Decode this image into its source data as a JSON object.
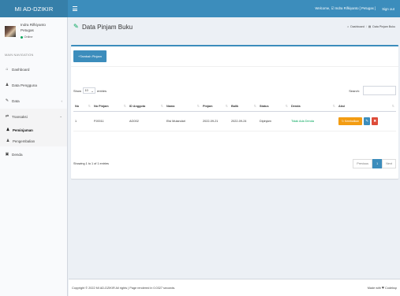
{
  "app": {
    "logo": "MI AD-DZIKIR"
  },
  "topbar": {
    "welcome": "Welcome, ☑ Indra Rifkiyanto [ Petugas ]",
    "signout": "Sign out"
  },
  "user": {
    "name": "Indra Rifkiyanto",
    "role": "Petugas",
    "status": "Online"
  },
  "sidebar": {
    "header": "MAIN NAVIGATION",
    "items": [
      {
        "icon": "⌂",
        "label": "Dashboard"
      },
      {
        "icon": "♟",
        "label": "Data Pengguna"
      },
      {
        "icon": "✎",
        "label": "Data",
        "chevron": "‹"
      },
      {
        "icon": "⇄",
        "label": "Transaksi",
        "chevron": "⌄"
      },
      {
        "icon": "♟",
        "label": "Peminjaman"
      },
      {
        "icon": "♟",
        "label": "Pengembalian"
      },
      {
        "icon": "▣",
        "label": "Denda"
      }
    ]
  },
  "page": {
    "title": "Data Pinjam Buku",
    "title_icon": "✎"
  },
  "breadcrumb": {
    "home": "Dashboard",
    "sep": "/",
    "current": "Data Pinjam Buku"
  },
  "box": {
    "add_button": "+Tambah Pinjam",
    "show_label": "Show",
    "show_value": "10",
    "entries_label": "entries",
    "search_label": "Search:"
  },
  "table": {
    "columns": [
      "No",
      "No Pinjam",
      "ID Anggota",
      "Nama",
      "Pinjam",
      "Balik",
      "Status",
      "Denda",
      "Aksi"
    ],
    "rows": [
      {
        "no": "1",
        "no_pinjam": "PJ0011",
        "id_anggota": "AG002",
        "nama": "Elsi Mulandari",
        "pinjam": "2022-09-21",
        "balik": "2022-09-24",
        "status": "Dipinjam",
        "denda": "Tidak Ada Denda"
      }
    ],
    "actions": {
      "kembali": "↻ Kembalikan",
      "edit": "✎",
      "delete": "✖"
    }
  },
  "pagination": {
    "info": "Showing 1 to 1 of 1 entries",
    "previous": "Previous",
    "page": "1",
    "next": "Next"
  },
  "footer": {
    "copyright": "Copyright © 2022 MI AD-DZIKIR All rights | Page rendered in 0.0327 seconds.",
    "made": "Made with",
    "made_by": "Codeksp"
  },
  "colors": {
    "primary": "#3c8dbc",
    "logo_bg": "#367fa9",
    "success": "#00a65a",
    "warning": "#f39c12",
    "danger": "#dd4b39"
  }
}
